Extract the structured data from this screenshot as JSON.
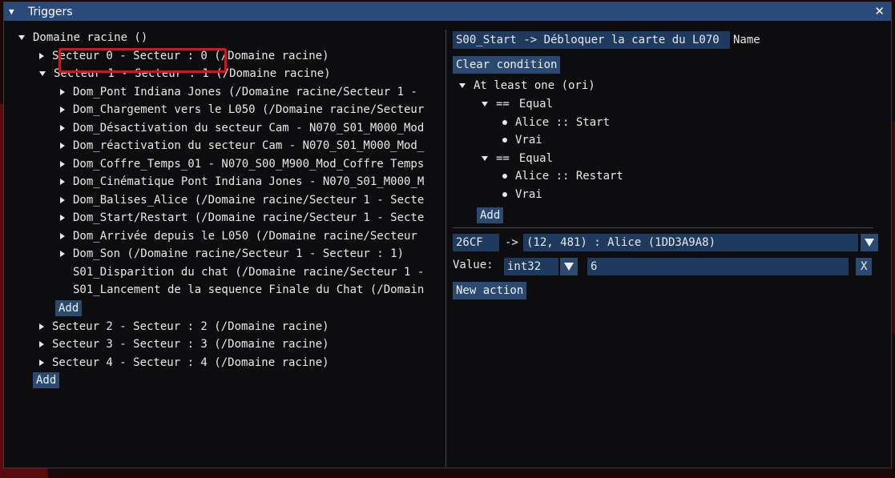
{
  "window": {
    "title": "Triggers",
    "close_glyph": "✕"
  },
  "tree": {
    "root": "Domaine racine ()",
    "sector0": "Secteur 0 - Secteur : 0 (/Domaine racine)",
    "sector1": "Secteur 1 - Secteur : 1 (/Domaine racine)",
    "sector1_children": [
      {
        "label": "Dom_Pont Indiana Jones (/Domaine racine/Secteur 1 -",
        "arrow": true
      },
      {
        "label": "Dom_Chargement vers le L050 (/Domaine racine/Secteur",
        "arrow": true
      },
      {
        "label": "Dom_Désactivation du secteur Cam - N070_S01_M000_Mod",
        "arrow": true
      },
      {
        "label": "Dom_réactivation du secteur Cam - N070_S01_M000_Mod_",
        "arrow": true
      },
      {
        "label": "Dom_Coffre_Temps_01 - N070_S00_M900_Mod_Coffre Temps",
        "arrow": true
      },
      {
        "label": "Dom_Cinématique Pont Indiana Jones - N070_S01_M000_M",
        "arrow": true
      },
      {
        "label": "Dom_Balises_Alice (/Domaine racine/Secteur 1 - Secte",
        "arrow": true
      },
      {
        "label": "Dom_Start/Restart (/Domaine racine/Secteur 1 - Secte",
        "arrow": true
      },
      {
        "label": "Dom_Arrivée depuis le L050 (/Domaine racine/Secteur",
        "arrow": true
      },
      {
        "label": "Dom_Son (/Domaine racine/Secteur 1 - Secteur : 1)",
        "arrow": true
      },
      {
        "label": "S01_Disparition du chat (/Domaine racine/Secteur 1 -",
        "arrow": false
      },
      {
        "label": "S01_Lancement de la sequence Finale du Chat (/Domain",
        "arrow": false
      }
    ],
    "sector1_add": "Add",
    "sector2": "Secteur 2 - Secteur : 2 (/Domaine racine)",
    "sector3": "Secteur 3 - Secteur : 3 (/Domaine racine)",
    "sector4": "Secteur 4 - Secteur : 4 (/Domaine racine)",
    "root_add": "Add"
  },
  "detail": {
    "trigger_name_value": "S00_Start -> Débloquer la carte du L070",
    "name_label": "Name",
    "clear_condition": "Clear condition",
    "condition": {
      "root": "At least one (ori)",
      "equal1_op": "==",
      "equal1_label": "Equal",
      "equal1_a": "Alice :: Start",
      "equal1_b": "Vrai",
      "equal2_op": "==",
      "equal2_label": "Equal",
      "equal2_a": "Alice :: Restart",
      "equal2_b": "Vrai",
      "add": "Add"
    },
    "action": {
      "id": "26CF",
      "arrow": "->",
      "target": "(12, 481) : Alice (1DD3A9A8)",
      "value_label": "Value:",
      "type": "int32",
      "value": "6",
      "remove": "X",
      "new_action": "New action"
    }
  },
  "colors": {
    "title_bar": "#294a7a",
    "button": "#2b4a72",
    "highlight": "#e0101a",
    "window_bg": "#0d0d0f"
  }
}
